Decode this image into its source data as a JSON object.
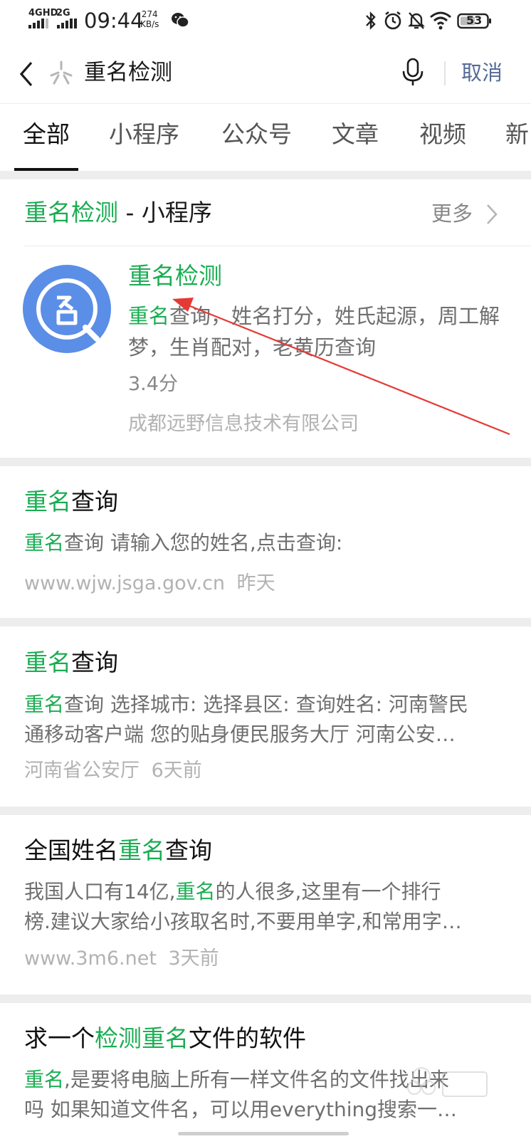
{
  "status_bar": {
    "net1": "4GHD",
    "net2": "2G",
    "time": "09:44",
    "speed_value": "274",
    "speed_unit": "KB/s",
    "battery": "53"
  },
  "search": {
    "query": "重名检测",
    "cancel_label": "取消"
  },
  "tabs": [
    "全部",
    "小程序",
    "公众号",
    "文章",
    "视频",
    "新"
  ],
  "mini_program_section": {
    "keyword": "重名检测",
    "suffix": " - 小程序",
    "more_label": "更多",
    "item": {
      "name": "重名检测",
      "desc_highlight": "重名",
      "desc_rest": "查询，姓名打分，姓氏起源，周工解梦，生肖配对，老黄历查询",
      "rating": "3.4分",
      "company": "成都远野信息技术有限公司"
    }
  },
  "results": [
    {
      "title_hl": "重名",
      "title_rest": "查询",
      "snippet_hl": "重名",
      "snippet_rest": "查询 请输入您的姓名,点击查询:",
      "source": "www.wjw.jsga.gov.cn",
      "time": "昨天"
    },
    {
      "title_hl": "重名",
      "title_rest": "查询",
      "snippet_hl": "重名",
      "snippet_line1_rest": "查询 选择城市: 选择县区: 查询姓名: 河南警民",
      "snippet_line2": "通移动客户端 您的贴身便民服务大厅 河南公安…",
      "source": "河南省公安厅",
      "time": "6天前"
    },
    {
      "title_pre": "全国姓名",
      "title_hl": "重名",
      "title_post": "查询",
      "snippet_pre": "我国人口有14亿,",
      "snippet_hl": "重名",
      "snippet_line1_rest": "的人很多,这里有一个排行",
      "snippet_line2": "榜.建议大家给小孩取名时,不要用单字,和常用字…",
      "source": "www.3m6.net",
      "time": "3天前"
    },
    {
      "title_pre": "求一个",
      "title_hl1": "检测",
      "title_hl2": "重名",
      "title_post": "文件的软件",
      "snippet_hl": "重名",
      "snippet_line1_rest": ",是要将电脑上所有一样文件名的文件找出来",
      "snippet_line2": "吗 如果知道文件名，可以用everything搜索一…"
    }
  ],
  "colors": {
    "highlight": "#1aad52",
    "link": "#576b95",
    "annotation_arrow": "#e53935",
    "app_icon": "#5b8ee6"
  }
}
